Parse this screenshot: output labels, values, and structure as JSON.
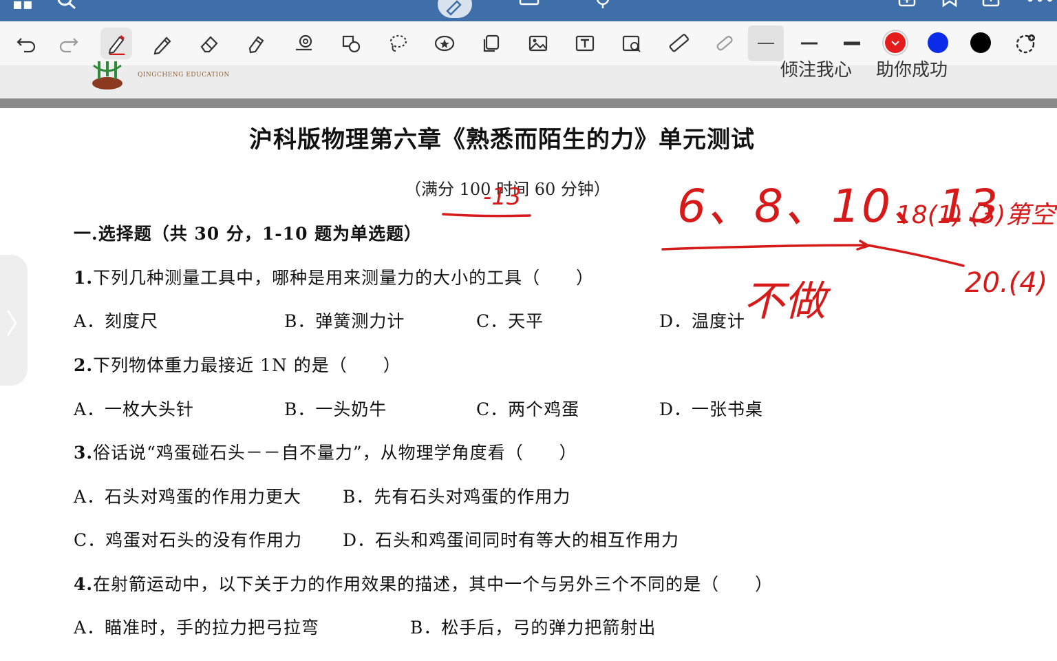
{
  "toolbar": {
    "tools": [
      "undo",
      "redo",
      "pen",
      "pencil",
      "eraser",
      "highlighter",
      "lasso-shape",
      "shapes",
      "lasso",
      "sticker",
      "copy",
      "image",
      "text",
      "scan",
      "ruler",
      "laser"
    ],
    "colors": [
      "#e51c1c",
      "#0a2be8",
      "#000000"
    ],
    "selected_color": "#e51c1c"
  },
  "header": {
    "logo_en": "QINGCHENG EDUCATION",
    "slogan_left": "倾注我心",
    "slogan_right": "助你成功"
  },
  "document": {
    "title": "沪科版物理第六章《熟悉而陌生的力》单元测试",
    "subtitle": "（满分 100  时间 60 分钟）",
    "section": "一.选择题（共 30 分，1-10 题为单选题）",
    "questions": [
      {
        "num": "1.",
        "text": "下列几种测量工具中，哪种是用来测量力的大小的工具（　　）",
        "options": [
          "A．刻度尺",
          "B．弹簧测力计",
          "C．天平",
          "D．温度计"
        ]
      },
      {
        "num": "2.",
        "text": "下列物体重力最接近 1N 的是（　　）",
        "options": [
          "A．一枚大头针",
          "B．一头奶牛",
          "C．两个鸡蛋",
          "D．一张书桌"
        ]
      },
      {
        "num": "3.",
        "text": "俗话说“鸡蛋碰石头－－自不量力”，从物理学角度看（　　）",
        "options": [
          "A．石头对鸡蛋的作用力更大",
          "B．先有石头对鸡蛋的作用力",
          "C．鸡蛋对石头的没有作用力",
          "D．石头和鸡蛋间同时有等大的相互作用力"
        ]
      },
      {
        "num": "4.",
        "text": "在射箭运动中，以下关于力的作用效果的描述，其中一个与另外三个不同的是（　　）",
        "options": [
          "A．瞄准时，手的拉力把弓拉弯",
          "B．松手后，弓的弹力把箭射出"
        ]
      }
    ]
  },
  "annotations": {
    "ink_color": "#d61a1a",
    "score_note": "-13",
    "skip_list": "6、8、10、13",
    "skip_list2": "18(1) (3)第空",
    "skip_list3": "20.(4)",
    "skip_label": "不做"
  }
}
